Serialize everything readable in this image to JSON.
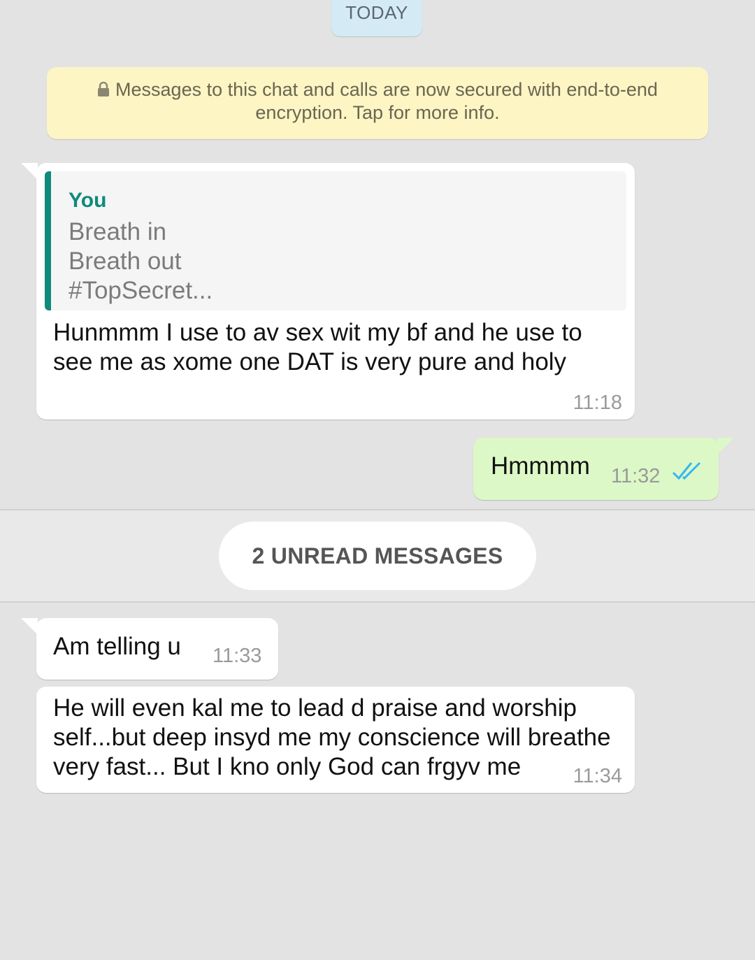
{
  "date_chip": "TODAY",
  "encryption_notice": {
    "line1": "Messages to this chat and calls are now secured with end-to-end",
    "line2": "encryption. Tap for more info.",
    "icon": "lock-icon"
  },
  "messages": [
    {
      "direction": "in",
      "quote": {
        "author": "You",
        "lines": [
          "Breath in",
          "Breath out",
          "#TopSecret..."
        ]
      },
      "lines": [
        "Hunmmm I use to av sex wit my bf and he use to",
        "see me as xome one DAT is very pure and holy"
      ],
      "time": "11:18"
    },
    {
      "direction": "out",
      "text": "Hmmmm",
      "time": "11:32",
      "status": "read",
      "status_color": "#34b7f1"
    },
    {
      "direction": "in",
      "text": "Am telling u",
      "time": "11:33"
    },
    {
      "direction": "in",
      "lines": [
        "He will even kal me to lead d praise and worship",
        "self...but deep insyd me my conscience will breathe",
        "very fast... But I kno only God can frgyv me"
      ],
      "time": "11:34"
    }
  ],
  "unread_divider": "2 UNREAD MESSAGES",
  "colors": {
    "background": "#e3e3e3",
    "incoming": "#ffffff",
    "outgoing": "#dcf8c6",
    "quote_accent": "#0f8a7b",
    "encryption_bg": "#fdf5c4"
  }
}
